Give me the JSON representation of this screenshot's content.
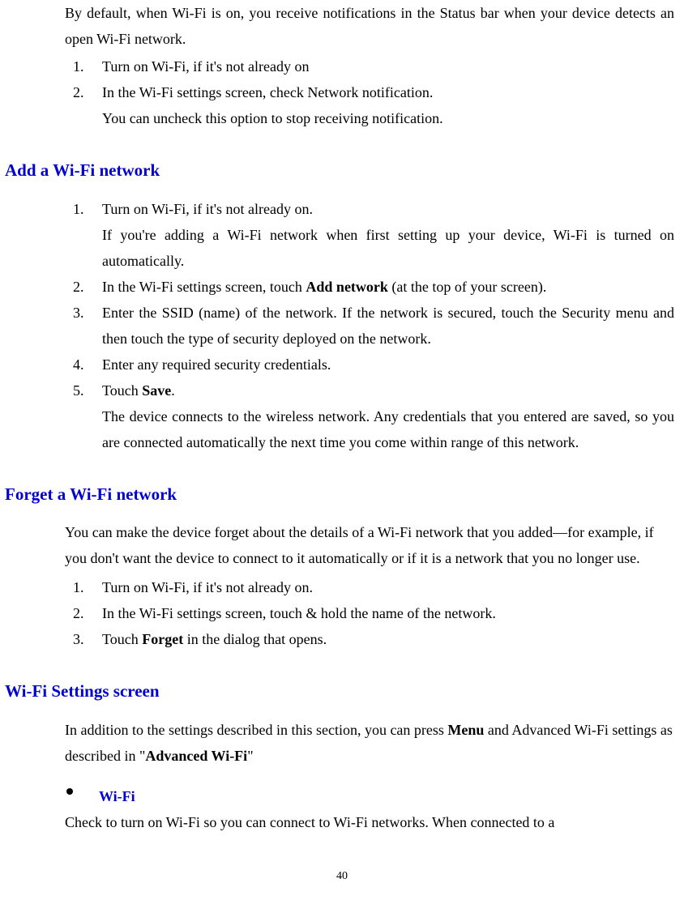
{
  "top": {
    "intro": "By default, when Wi-Fi is on, you receive notifications in the Status bar when your device detects an open Wi-Fi network.",
    "steps": [
      {
        "num": "1.",
        "text": "Turn on Wi-Fi, if it's not already on"
      },
      {
        "num": "2.",
        "text": "In the Wi-Fi settings screen, check Network notification."
      }
    ],
    "afterNote": "You can uncheck this option to stop receiving notification."
  },
  "addNetwork": {
    "title": "Add a Wi-Fi network",
    "steps": [
      {
        "num": "1.",
        "text": "Turn on Wi-Fi, if it's not already on.",
        "sub": "If you're adding a Wi-Fi network when first setting up your device, Wi-Fi is turned on automatically."
      },
      {
        "num": "2.",
        "pre": "In the Wi-Fi settings screen, touch ",
        "bold": "Add network",
        "post": " (at the top of your screen)."
      },
      {
        "num": "3.",
        "text": "Enter the SSID (name) of the network. If the network is secured, touch the Security menu and then touch the type of security deployed on the network."
      },
      {
        "num": "4.",
        "text": "Enter any required security credentials."
      },
      {
        "num": "5.",
        "pre": "Touch ",
        "bold": "Save",
        "post": ".",
        "sub": "The device connects to the wireless network. Any credentials that you entered are saved, so you are connected automatically the next time you come within range of this network."
      }
    ]
  },
  "forgetNetwork": {
    "title": "Forget a Wi-Fi network",
    "intro": "You can make the device forget about the details of a Wi-Fi network that you added—for example, if you don't want the device to connect to it automatically or if it is a network that you no longer use.",
    "steps": [
      {
        "num": "1.",
        "text": "Turn on Wi-Fi, if it's not already on."
      },
      {
        "num": "2.",
        "text": "In the Wi-Fi settings screen, touch & hold the name of the network."
      },
      {
        "num": "3.",
        "pre": "Touch ",
        "bold": "Forget",
        "post": " in the dialog that opens."
      }
    ]
  },
  "wifiSettings": {
    "title": "Wi-Fi Settings screen",
    "intro_pre": "In addition to the settings described in this section, you can press ",
    "intro_bold1": "Menu",
    "intro_mid": " and Advanced Wi-Fi settings as described in \"",
    "intro_bold2": "Advanced Wi-Fi",
    "intro_post": "\"",
    "sub": {
      "title": "Wi-Fi",
      "body": "Check to turn on Wi-Fi so you can connect to Wi-Fi networks. When connected to a"
    }
  },
  "pageNumber": "40"
}
